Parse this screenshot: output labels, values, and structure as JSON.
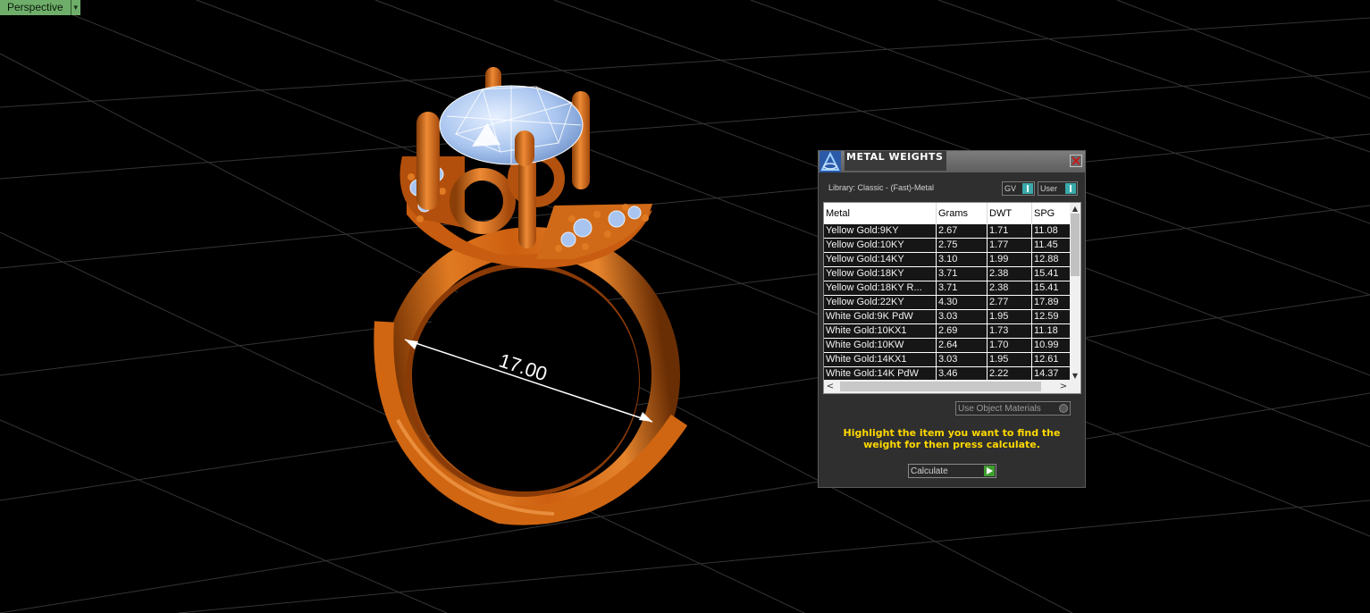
{
  "viewport": {
    "tab_label": "Perspective",
    "dimension_label": "17.00",
    "colors": {
      "metal": "#cc5f10",
      "stone": "#a9c5ef",
      "grid": "#3a3a3a",
      "background": "#000000"
    }
  },
  "panel": {
    "title": "METAL WEIGHTS",
    "library_label": "Library: Classic - (Fast)-Metal",
    "toggles": [
      {
        "label": "GV"
      },
      {
        "label": "User"
      }
    ],
    "columns": [
      "Metal",
      "Grams",
      "DWT",
      "SPG"
    ],
    "rows": [
      [
        "Yellow Gold:9KY",
        "2.67",
        "1.71",
        "11.08"
      ],
      [
        "Yellow Gold:10KY",
        "2.75",
        "1.77",
        "11.45"
      ],
      [
        "Yellow Gold:14KY",
        "3.10",
        "1.99",
        "12.88"
      ],
      [
        "Yellow Gold:18KY",
        "3.71",
        "2.38",
        "15.41"
      ],
      [
        "Yellow Gold:18KY R...",
        "3.71",
        "2.38",
        "15.41"
      ],
      [
        "Yellow Gold:22KY",
        "4.30",
        "2.77",
        "17.89"
      ],
      [
        "White Gold:9K PdW",
        "3.03",
        "1.95",
        "12.59"
      ],
      [
        "White Gold:10KX1",
        "2.69",
        "1.73",
        "11.18"
      ],
      [
        "White Gold:10KW",
        "2.64",
        "1.70",
        "10.99"
      ],
      [
        "White Gold:14KX1",
        "3.03",
        "1.95",
        "12.61"
      ],
      [
        "White Gold:14K PdW",
        "3.46",
        "2.22",
        "14.37"
      ]
    ],
    "use_object_materials": "Use Object Materials",
    "hint": "Highlight the item you want to find the weight for then press calculate.",
    "calculate_label": "Calculate",
    "accent_colors": {
      "hint": "#ffd800",
      "toggle": "#3aa9a9",
      "calculate": "#3e9e2e"
    }
  }
}
